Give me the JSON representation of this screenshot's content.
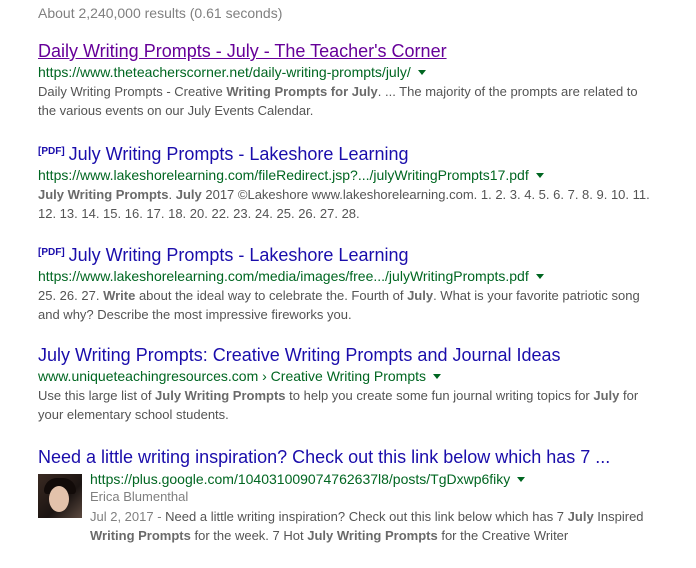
{
  "stats": "About 2,240,000 results (0.61 seconds)",
  "results": [
    {
      "title": "Daily Writing Prompts - July - The Teacher's Corner",
      "url": "https://www.theteacherscorner.net/daily-writing-prompts/july/",
      "snippet": [
        {
          "t": "Daily Writing Prompts - Creative "
        },
        {
          "t": "Writing Prompts for July",
          "b": true
        },
        {
          "t": ". ... The majority of the prompts are related to the various events on our July Events Calendar."
        }
      ]
    },
    {
      "tag": "[PDF]",
      "title": "July Writing Prompts - Lakeshore Learning",
      "url": "https://www.lakeshorelearning.com/fileRedirect.jsp?.../julyWritingPrompts17.pdf",
      "snippet": [
        {
          "t": "July Writing Prompts",
          "b": true
        },
        {
          "t": ". "
        },
        {
          "t": "July",
          "b": true
        },
        {
          "t": " 2017 ©Lakeshore www.lakeshorelearning.com. 1. 2. 3. 4. 5. 6. 7. 8. 9. 10. 11. 12. 13. 14. 15. 16. 17. 18. 20. 22. 23. 24. 25. 26. 27. 28."
        }
      ]
    },
    {
      "tag": "[PDF]",
      "title": "July Writing Prompts - Lakeshore Learning",
      "url": "https://www.lakeshorelearning.com/media/images/free.../julyWritingPrompts.pdf",
      "snippet": [
        {
          "t": "25. 26. 27. "
        },
        {
          "t": "Write",
          "b": true
        },
        {
          "t": " about the ideal way to celebrate the. Fourth of "
        },
        {
          "t": "July",
          "b": true
        },
        {
          "t": ". What is your favorite patriotic song and why? Describe the most impressive fireworks you."
        }
      ]
    },
    {
      "title": "July Writing Prompts: Creative Writing Prompts and Journal Ideas",
      "url": "www.uniqueteachingresources.com › Creative Writing Prompts",
      "snippet": [
        {
          "t": "Use this large list of "
        },
        {
          "t": "July Writing Prompts",
          "b": true
        },
        {
          "t": " to help you create some fun journal writing topics for "
        },
        {
          "t": "July",
          "b": true
        },
        {
          "t": " for your elementary school students."
        }
      ]
    }
  ],
  "social_result": {
    "title": "Need a little writing inspiration? Check out this link below which has 7 ...",
    "url": "https://plus.google.com/104031009074762637l8/posts/TgDxwp6fiky",
    "author": "Erica Blumenthal",
    "date": "Jul 2, 2017",
    "separator": " - ",
    "snippet": [
      {
        "t": "Need a little writing inspiration? Check out this link below which has 7 "
      },
      {
        "t": "July",
        "b": true
      },
      {
        "t": " Inspired "
      },
      {
        "t": "Writing Prompts",
        "b": true
      },
      {
        "t": " for the week. 7 Hot "
      },
      {
        "t": "July Writing Prompts",
        "b": true
      },
      {
        "t": " for the Creative Writer"
      }
    ]
  },
  "colors": {
    "link": "#1a0dab",
    "visited": "#660099",
    "url": "#006621",
    "snippet": "#545454"
  }
}
